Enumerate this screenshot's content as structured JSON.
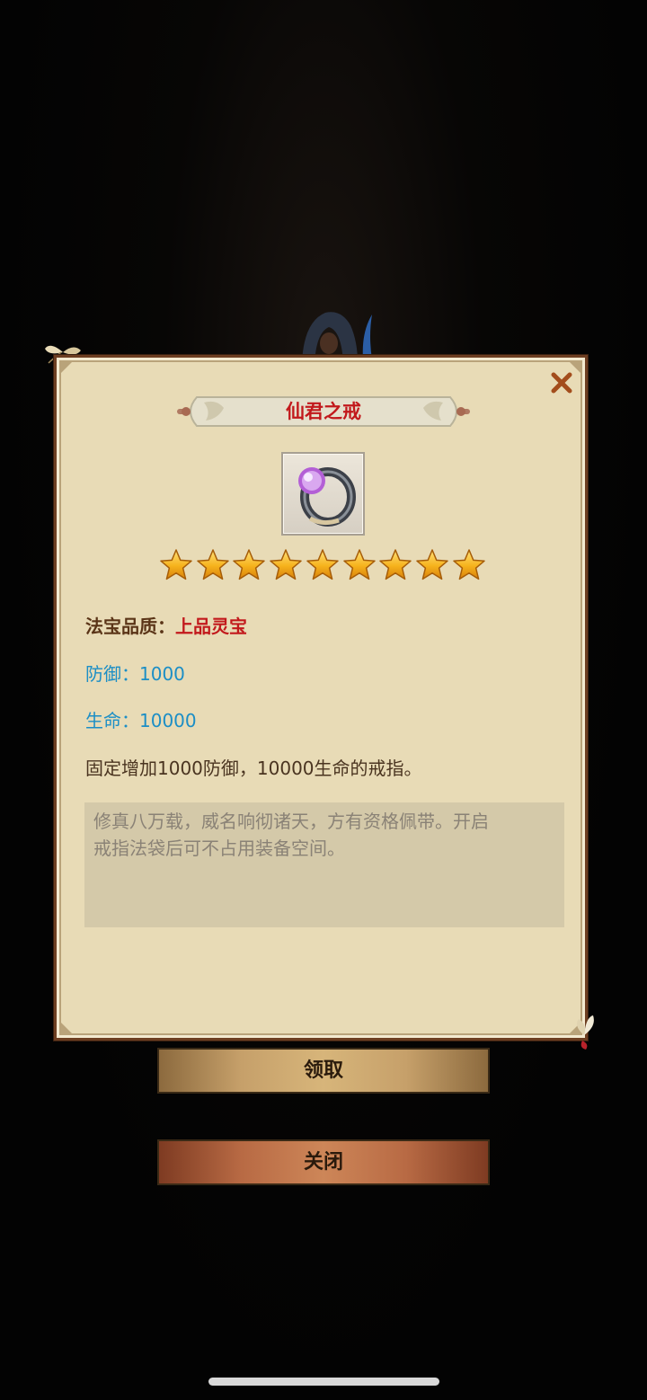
{
  "dialog": {
    "title": "仙君之戒",
    "item_icon": "ring-icon",
    "star_count": 9,
    "quality_label": "法宝品质：",
    "quality_value": "上品灵宝",
    "defense_text": "防御：1000",
    "life_text": "生命：10000",
    "effect_text": "固定增加1000防御，10000生命的戒指。",
    "lore_lines": [
      "修真八万载，威名响彻诸天，方有资格佩带。开启",
      "戒指法袋后可不占用装备空间。"
    ],
    "close_icon": "close-icon"
  },
  "buttons": {
    "claim_label": "领取",
    "close_label": "关闭"
  },
  "colors": {
    "panel_bg": "#e8dbb6",
    "title": "#c2191c",
    "stat_blue": "#1b8ec6",
    "label_brown": "#5a3417"
  }
}
